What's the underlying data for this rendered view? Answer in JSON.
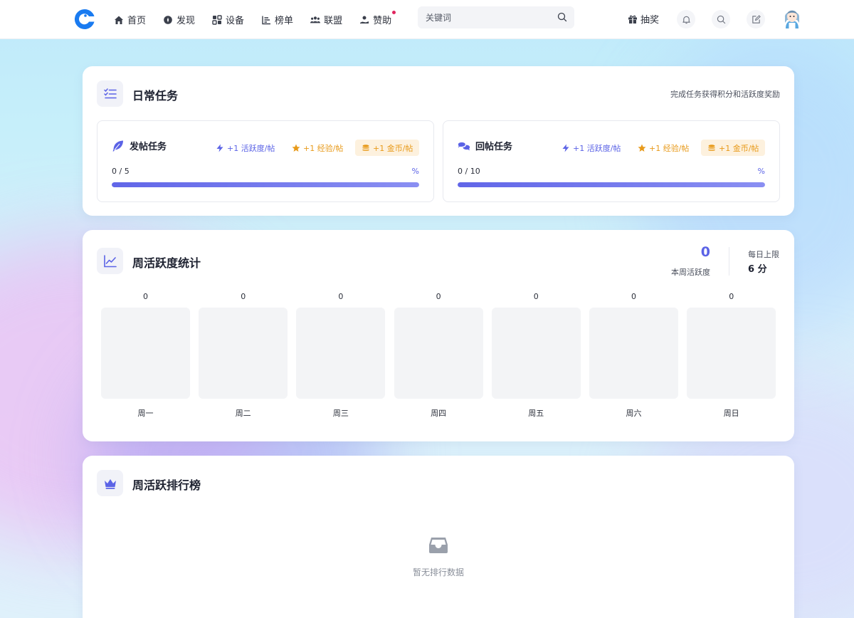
{
  "header": {
    "nav": [
      {
        "label": "首页",
        "icon": "home-icon"
      },
      {
        "label": "发现",
        "icon": "compass-icon"
      },
      {
        "label": "设备",
        "icon": "device-icon"
      },
      {
        "label": "榜单",
        "icon": "ranking-icon"
      },
      {
        "label": "联盟",
        "icon": "users-icon"
      },
      {
        "label": "赞助",
        "icon": "sponsor-icon",
        "badge_dot": true
      }
    ],
    "search_placeholder": "关键词",
    "lottery_label": "抽奖",
    "accent_color": "#1a7bf0",
    "badge_color": "#e0245e"
  },
  "daily": {
    "title": "日常任务",
    "subtitle": "完成任务获得积分和活跃度奖励",
    "tasks": [
      {
        "name": "发帖任务",
        "icon": "feather-icon",
        "rewards": [
          "+1 活跃度/帖",
          "+1 经验/帖",
          "+1 金币/帖"
        ],
        "count": "0 / 5",
        "percent": "%",
        "progress": 1
      },
      {
        "name": "回帖任务",
        "icon": "chat-bubbles-icon",
        "rewards": [
          "+1 活跃度/帖",
          "+1 经验/帖",
          "+1 金币/帖"
        ],
        "count": "0 / 10",
        "percent": "%",
        "progress": 1
      }
    ]
  },
  "weekly": {
    "title": "周活跃度统计",
    "total": "0",
    "total_label": "本周活跃度",
    "limit_label": "每日上限",
    "limit_value": "6 分",
    "accent_color": "#5b63e6"
  },
  "chart_data": {
    "type": "bar",
    "categories": [
      "周一",
      "周二",
      "周三",
      "周四",
      "周五",
      "周六",
      "周日"
    ],
    "values": [
      0,
      0,
      0,
      0,
      0,
      0,
      0
    ],
    "ylim": [
      0,
      6
    ]
  },
  "ranking": {
    "title": "周活跃排行榜",
    "empty_text": "暂无排行数据",
    "empty_icon": "inbox-icon"
  }
}
